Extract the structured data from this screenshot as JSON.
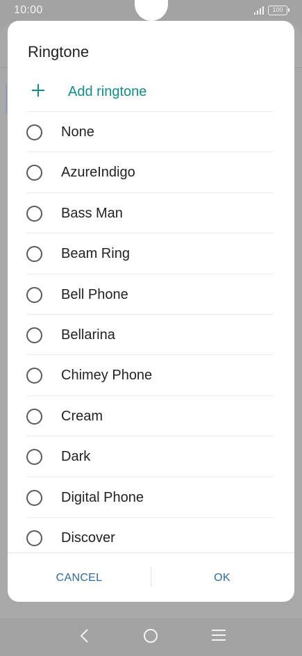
{
  "status_bar": {
    "time": "10:00",
    "battery": "100"
  },
  "dialog": {
    "title": "Ringtone",
    "add_label": "Add ringtone",
    "items": [
      {
        "label": "None",
        "selected": false
      },
      {
        "label": "AzureIndigo",
        "selected": false
      },
      {
        "label": "Bass Man",
        "selected": false
      },
      {
        "label": "Beam Ring",
        "selected": false
      },
      {
        "label": "Bell Phone",
        "selected": false
      },
      {
        "label": "Bellarina",
        "selected": false
      },
      {
        "label": "Chimey Phone",
        "selected": false
      },
      {
        "label": "Cream",
        "selected": false
      },
      {
        "label": "Dark",
        "selected": false
      },
      {
        "label": "Digital Phone",
        "selected": false
      },
      {
        "label": "Discover",
        "selected": false
      }
    ],
    "cancel_label": "CANCEL",
    "ok_label": "OK"
  },
  "colors": {
    "accent": "#0d8f87",
    "button": "#2c6aa8"
  },
  "icons": {
    "add": "plus-icon",
    "back": "back-icon",
    "home": "home-icon",
    "menu": "menu-icon"
  }
}
